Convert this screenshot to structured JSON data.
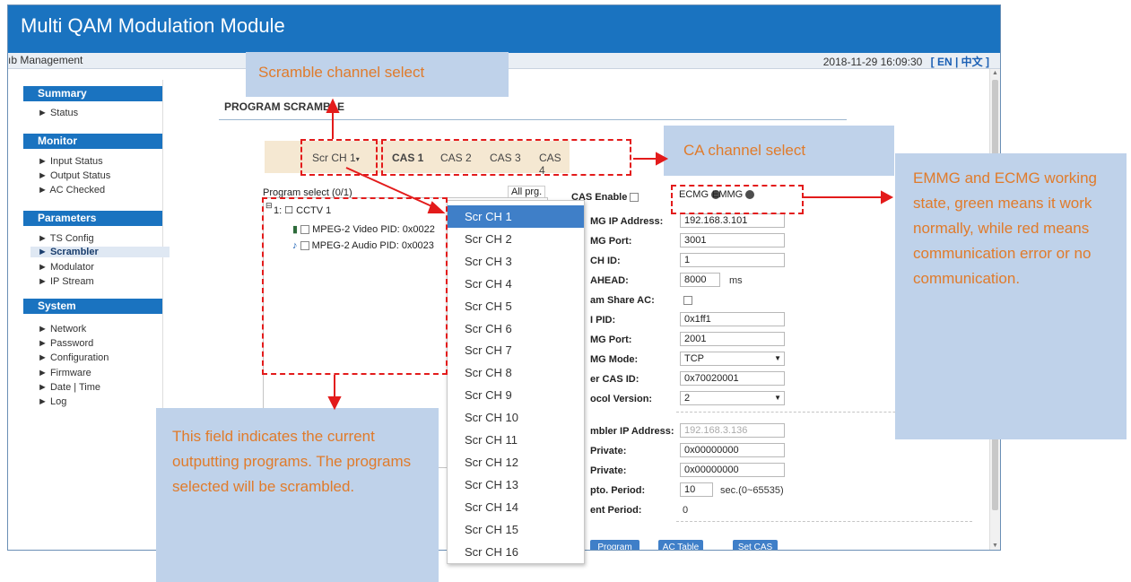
{
  "app": {
    "title": "Multi QAM Modulation Module"
  },
  "subbar": {
    "left": "ıb Management",
    "datetime": "2018-11-29 16:09:30",
    "lang": "[ EN | 中文 ]"
  },
  "sidebar": {
    "summary": {
      "head": "Summary",
      "items": [
        "Status"
      ]
    },
    "monitor": {
      "head": "Monitor",
      "items": [
        "Input Status",
        "Output Status",
        "AC Checked"
      ]
    },
    "parameters": {
      "head": "Parameters",
      "items": [
        "TS Config",
        "Scrambler",
        "Modulator",
        "IP Stream"
      ]
    },
    "system": {
      "head": "System",
      "items": [
        "Network",
        "Password",
        "Configuration",
        "Firmware",
        "Date | Time",
        "Log"
      ]
    }
  },
  "page": {
    "title": "PROGRAM SCRAMBLE"
  },
  "tabs": {
    "scr": "Scr CH 1",
    "cas": [
      "CAS 1",
      "CAS 2",
      "CAS 3",
      "CAS 4"
    ]
  },
  "tree": {
    "header": "Program select (0/1)",
    "all": "All prg.",
    "program": "1: ☐ CCTV 1",
    "video": "MPEG-2 Video PID: 0x0022",
    "audio": "MPEG-2 Audio PID: 0x0023"
  },
  "cas_form": {
    "cas_enable": "CAS Enable",
    "ecmg": "ECMG",
    "emmg": "EMMG",
    "ip_label": "MG IP Address:",
    "ip_value": "192.168.3.101",
    "port_label": "MG Port:",
    "port_value": "3001",
    "chid_label": "CH ID:",
    "chid_value": "1",
    "ahead_label": "AHEAD:",
    "ahead_value": "8000",
    "ahead_unit": "ms",
    "share_label": "am Share AC:",
    "pid_label": "I PID:",
    "pid_value": "0x1ff1",
    "emmg_port_label": "MG Port:",
    "emmg_port_value": "2001",
    "mode_label": "MG Mode:",
    "mode_value": "TCP",
    "super_label": "er CAS ID:",
    "super_value": "0x70020001",
    "proto_label": "ocol Version:",
    "proto_value": "2",
    "scr_ip_label": "mbler IP Address:",
    "scr_ip_value": "192.168.3.136",
    "priv1_label": "Private:",
    "priv1_value": "0x00000000",
    "priv2_label": "Private:",
    "priv2_value": "0x00000000",
    "crypto_label": "pto. Period:",
    "crypto_value": "10",
    "crypto_unit": "sec.(0~65535)",
    "current_label": "ent Period:",
    "current_value": "0"
  },
  "buttons": {
    "program": "Program",
    "ac_table": "AC Table",
    "set_cas": "Set CAS"
  },
  "dropdown": {
    "items": [
      "Scr CH 1",
      "Scr CH 2",
      "Scr CH 3",
      "Scr CH 4",
      "Scr CH 5",
      "Scr CH 6",
      "Scr CH 7",
      "Scr CH 8",
      "Scr CH 9",
      "Scr CH 10",
      "Scr CH 11",
      "Scr CH 12",
      "Scr CH 13",
      "Scr CH 14",
      "Scr CH 15",
      "Scr CH 16"
    ],
    "selected": "Scr CH 1"
  },
  "callouts": {
    "scramble": "Scramble channel select",
    "ca": "CA channel select",
    "emmg": "EMMG and ECMG working state, green means it work normally, while red means communication error or no communication.",
    "field": "This field indicates the current outputting programs. The programs selected will be scrambled."
  },
  "colors": {
    "accent": "#1a73c0",
    "annotation_text": "#e07b2b",
    "annotation_bg": "#bfd2ea",
    "dash": "#e31b1b"
  }
}
